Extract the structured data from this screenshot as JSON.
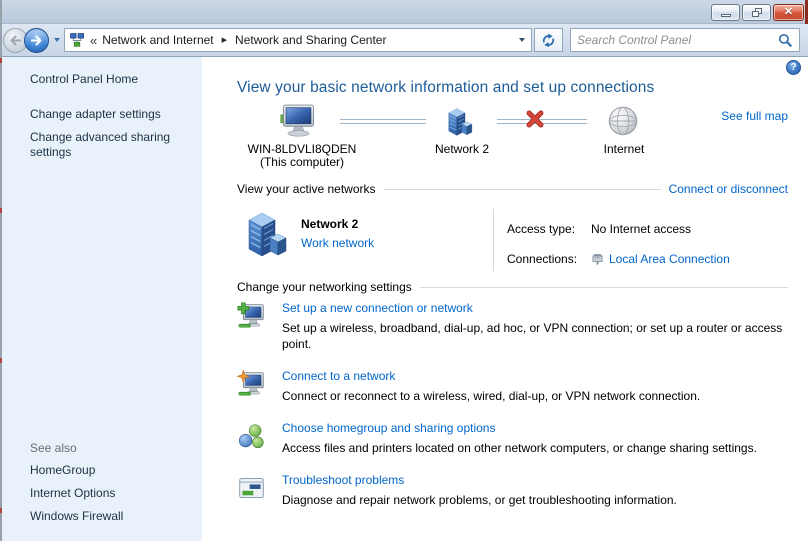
{
  "colors": {
    "link_blue": "#0066cc",
    "heading_blue": "#1d5c99",
    "sidebar_bg": "#e9f1fa",
    "sidebar_link_text": "#1c3144",
    "muted_gray": "#6d6d6d",
    "close_button_red": "#cf4c30",
    "broken_link_x_red": "#c8342a",
    "titlebar_top": "#ccd8e7",
    "navbar_top": "#dfe8f4"
  },
  "icons": {
    "back": "left-arrow-in-gray-circle",
    "forward": "right-arrow-in-blue-circle",
    "history_dropdown": "down-caret",
    "address_location": "network-computers",
    "breadcrumb_overflow": "«",
    "breadcrumb_separator": "▶",
    "address_dropdown": "down-caret",
    "refresh": "refresh-arrows",
    "search": "magnifier",
    "help": "?",
    "minimize": "dash",
    "restore": "overlapping-squares",
    "close": "✕",
    "map_computer": "computer-monitor",
    "map_network": "office-buildings",
    "map_internet": "globe",
    "map_broken": "red-x",
    "connections_device": "ethernet-plug"
  },
  "navbar": {
    "breadcrumb_items": [
      "Network and Internet",
      "Network and Sharing Center"
    ],
    "search_placeholder": "Search Control Panel"
  },
  "sidebar": {
    "home": "Control Panel Home",
    "tasks": [
      "Change adapter settings",
      "Change advanced sharing settings"
    ],
    "see_also": "See also",
    "links": [
      "HomeGroup",
      "Internet Options",
      "Windows Firewall"
    ]
  },
  "main": {
    "heading": "View your basic network information and set up connections",
    "see_full_map": "See full map",
    "map": {
      "computer_name": "WIN-8LDVLI8QDEN",
      "computer_caption": "(This computer)",
      "network_name": "Network 2",
      "internet_label": "Internet"
    },
    "active_networks": {
      "section_label": "View your active networks",
      "action_link": "Connect or disconnect",
      "network_name": "Network 2",
      "network_category": "Work network",
      "access_type_label": "Access type:",
      "access_type_value": "No Internet access",
      "connections_label": "Connections:",
      "connections_value": "Local Area Connection"
    },
    "settings": {
      "section_label": "Change your networking settings",
      "items": [
        {
          "title": "Set up a new connection or network",
          "description": "Set up a wireless, broadband, dial-up, ad hoc, or VPN connection; or set up a router or access point."
        },
        {
          "title": "Connect to a network",
          "description": "Connect or reconnect to a wireless, wired, dial-up, or VPN network connection."
        },
        {
          "title": "Choose homegroup and sharing options",
          "description": "Access files and printers located on other network computers, or change sharing settings."
        },
        {
          "title": "Troubleshoot problems",
          "description": "Diagnose and repair network problems, or get troubleshooting information."
        }
      ]
    }
  }
}
